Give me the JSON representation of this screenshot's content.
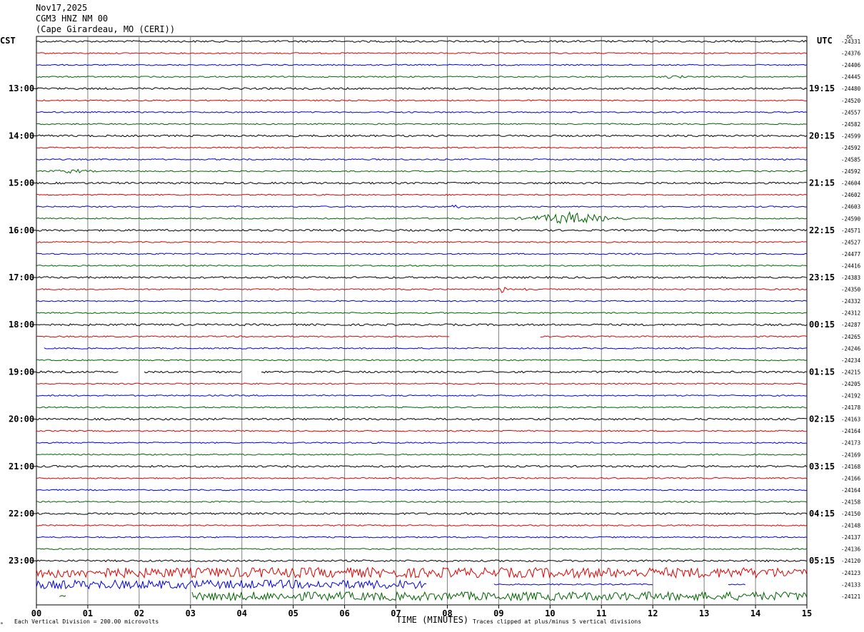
{
  "header": {
    "date": "Nov17,2025",
    "station": "CGM3 HNZ NM 00",
    "location": "(Cape Girardeau, MO (CERI))"
  },
  "left_timezone": "CST",
  "right_timezone": "UTC",
  "dc_label": "DC",
  "footer": {
    "scale_note": "Each Vertical Division =  200.00 microvolts",
    "xlabel": "TIME (MINUTES)",
    "clip_note": "Traces clipped at plus/minus 5 vertical divisions"
  },
  "colors": {
    "cycle": [
      "#000000",
      "#e00000",
      "#0000e0",
      "#006400"
    ],
    "grid": "#808080"
  },
  "chart_data": {
    "type": "line",
    "title": "",
    "xlabel": "TIME (MINUTES)",
    "ylabel": "",
    "x_ticks": [
      "00",
      "01",
      "02",
      "03",
      "04",
      "05",
      "06",
      "07",
      "08",
      "09",
      "10",
      "11",
      "12",
      "13",
      "14",
      "15"
    ],
    "xlim": [
      0,
      15
    ],
    "rows_per_hour": 4,
    "minutes_per_row": 15,
    "hour_labels_left": [
      {
        "row": 4,
        "label": "13:00"
      },
      {
        "row": 8,
        "label": "14:00"
      },
      {
        "row": 12,
        "label": "15:00"
      },
      {
        "row": 16,
        "label": "16:00"
      },
      {
        "row": 20,
        "label": "17:00"
      },
      {
        "row": 24,
        "label": "18:00"
      },
      {
        "row": 28,
        "label": "19:00"
      },
      {
        "row": 32,
        "label": "20:00"
      },
      {
        "row": 36,
        "label": "21:00"
      },
      {
        "row": 40,
        "label": "22:00"
      },
      {
        "row": 44,
        "label": "23:00"
      }
    ],
    "hour_labels_right": [
      {
        "row": 4,
        "label": "19:15"
      },
      {
        "row": 8,
        "label": "20:15"
      },
      {
        "row": 12,
        "label": "21:15"
      },
      {
        "row": 16,
        "label": "22:15"
      },
      {
        "row": 20,
        "label": "23:15"
      },
      {
        "row": 24,
        "label": "00:15"
      },
      {
        "row": 28,
        "label": "01:15"
      },
      {
        "row": 32,
        "label": "02:15"
      },
      {
        "row": 36,
        "label": "03:15"
      },
      {
        "row": 40,
        "label": "04:15"
      },
      {
        "row": 44,
        "label": "05:15"
      }
    ],
    "dc_offsets": [
      "-24331",
      "-24376",
      "-24406",
      "-24445",
      "-24480",
      "-24520",
      "-24557",
      "-24582",
      "-24599",
      "-24592",
      "-24585",
      "-24592",
      "-24604",
      "-24602",
      "-24603",
      "-24590",
      "-24571",
      "-24527",
      "-24477",
      "-24416",
      "-24383",
      "-24350",
      "-24332",
      "-24312",
      "-24287",
      "-24265",
      "-24246",
      "-24234",
      "-24215",
      "-24205",
      "-24192",
      "-24178",
      "-24163",
      "-24164",
      "-24173",
      "-24169",
      "-24168",
      "-24166",
      "-24164",
      "-24158",
      "-24150",
      "-24148",
      "-24137",
      "-24136",
      "-24120",
      "-24123",
      "-24133",
      "-24121"
    ],
    "events": [
      {
        "row": 15,
        "start_min": 9.3,
        "end_min": 11.5,
        "amp": 9,
        "note": "emergent signal"
      },
      {
        "row": 14,
        "start_min": 8.0,
        "end_min": 8.3,
        "amp": 4
      },
      {
        "row": 21,
        "start_min": 9.0,
        "end_min": 9.15,
        "amp": 8
      },
      {
        "row": 21,
        "start_min": 9.45,
        "end_min": 9.55,
        "amp": 8
      },
      {
        "row": 11,
        "start_min": 0.0,
        "end_min": 1.4,
        "amp": 3
      },
      {
        "row": 3,
        "start_min": 12.0,
        "end_min": 12.8,
        "amp": 3
      },
      {
        "row": 45,
        "start_min": 0.0,
        "end_min": 15.0,
        "amp": 7
      },
      {
        "row": 46,
        "start_min": 0.0,
        "end_min": 7.6,
        "amp": 6
      },
      {
        "row": 47,
        "start_min": 3.0,
        "end_min": 15.0,
        "amp": 6
      }
    ],
    "gaps": [
      {
        "row": 25,
        "start_min": 8.05,
        "end_min": 9.0
      },
      {
        "row": 25,
        "start_min": 9.0,
        "end_min": 9.8
      },
      {
        "row": 26,
        "start_min": 0.0,
        "end_min": 0.12
      },
      {
        "row": 28,
        "start_min": 1.6,
        "end_min": 2.1
      },
      {
        "row": 28,
        "start_min": 4.0,
        "end_min": 4.35
      },
      {
        "row": 46,
        "start_min": 7.6,
        "end_min": 8.9
      },
      {
        "row": 46,
        "start_min": 12.0,
        "end_min": 13.45
      },
      {
        "row": 46,
        "start_min": 13.8,
        "end_min": 15.0
      },
      {
        "row": 47,
        "start_min": 0.0,
        "end_min": 0.45
      },
      {
        "row": 47,
        "start_min": 0.6,
        "end_min": 3.0
      }
    ]
  }
}
